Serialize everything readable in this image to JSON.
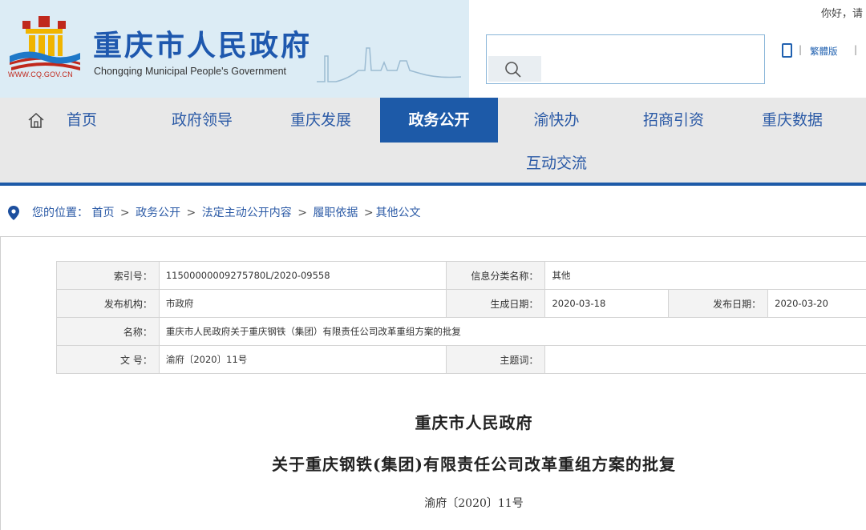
{
  "header": {
    "site_domain": "WWW.CQ.GOV.CN",
    "site_title": "重庆市人民政府",
    "site_subtitle": "Chongqing Municipal People's Government",
    "greeting": "你好，请",
    "search": {
      "placeholder": "",
      "button_icon": "search-icon"
    },
    "tools": {
      "mobile_icon": "mobile-phone-icon",
      "traditional_label": "繁體版"
    },
    "colors": {
      "brand_blue": "#1e58ae",
      "banner_bg": "#dcecf5",
      "logo_red": "#c0281c",
      "logo_yellow": "#f0b400"
    }
  },
  "nav": {
    "home_icon": "home-icon",
    "items": [
      {
        "label": "首页"
      },
      {
        "label": "政府领导"
      },
      {
        "label": "重庆发展"
      },
      {
        "label": "政务公开"
      },
      {
        "label": "渝快办"
      },
      {
        "label": "招商引资"
      },
      {
        "label": "重庆数据"
      },
      {
        "label": "互动交流"
      }
    ],
    "active_index": 3,
    "colors": {
      "active_bg": "#1d5aa8",
      "bar_bg": "#e8e8e8"
    }
  },
  "breadcrumb": {
    "icon": "location-pin-icon",
    "prefix": "您的位置：",
    "items": [
      "首页",
      "政务公开",
      "法定主动公开内容",
      "履职依据",
      "其他公文"
    ],
    "separator": ">"
  },
  "meta": {
    "index_label": "索引号：",
    "index_value": "11500000009275780L/2020-09558",
    "category_label": "信息分类名称：",
    "category_value": "其他",
    "agency_label": "发布机构：",
    "agency_value": "市政府",
    "created_label": "生成日期：",
    "created_value": "2020-03-18",
    "published_label": "发布日期：",
    "published_value": "2020-03-20",
    "name_label": "名称：",
    "name_value": "重庆市人民政府关于重庆钢铁（集团）有限责任公司改革重组方案的批复",
    "docno_label": "文 号：",
    "docno_value": "渝府〔2020〕11号",
    "subject_label": "主题词：",
    "subject_value": ""
  },
  "document": {
    "issuer": "重庆市人民政府",
    "title": "关于重庆钢铁(集团)有限责任公司改革重组方案的批复",
    "number": "渝府〔2020〕11号"
  }
}
